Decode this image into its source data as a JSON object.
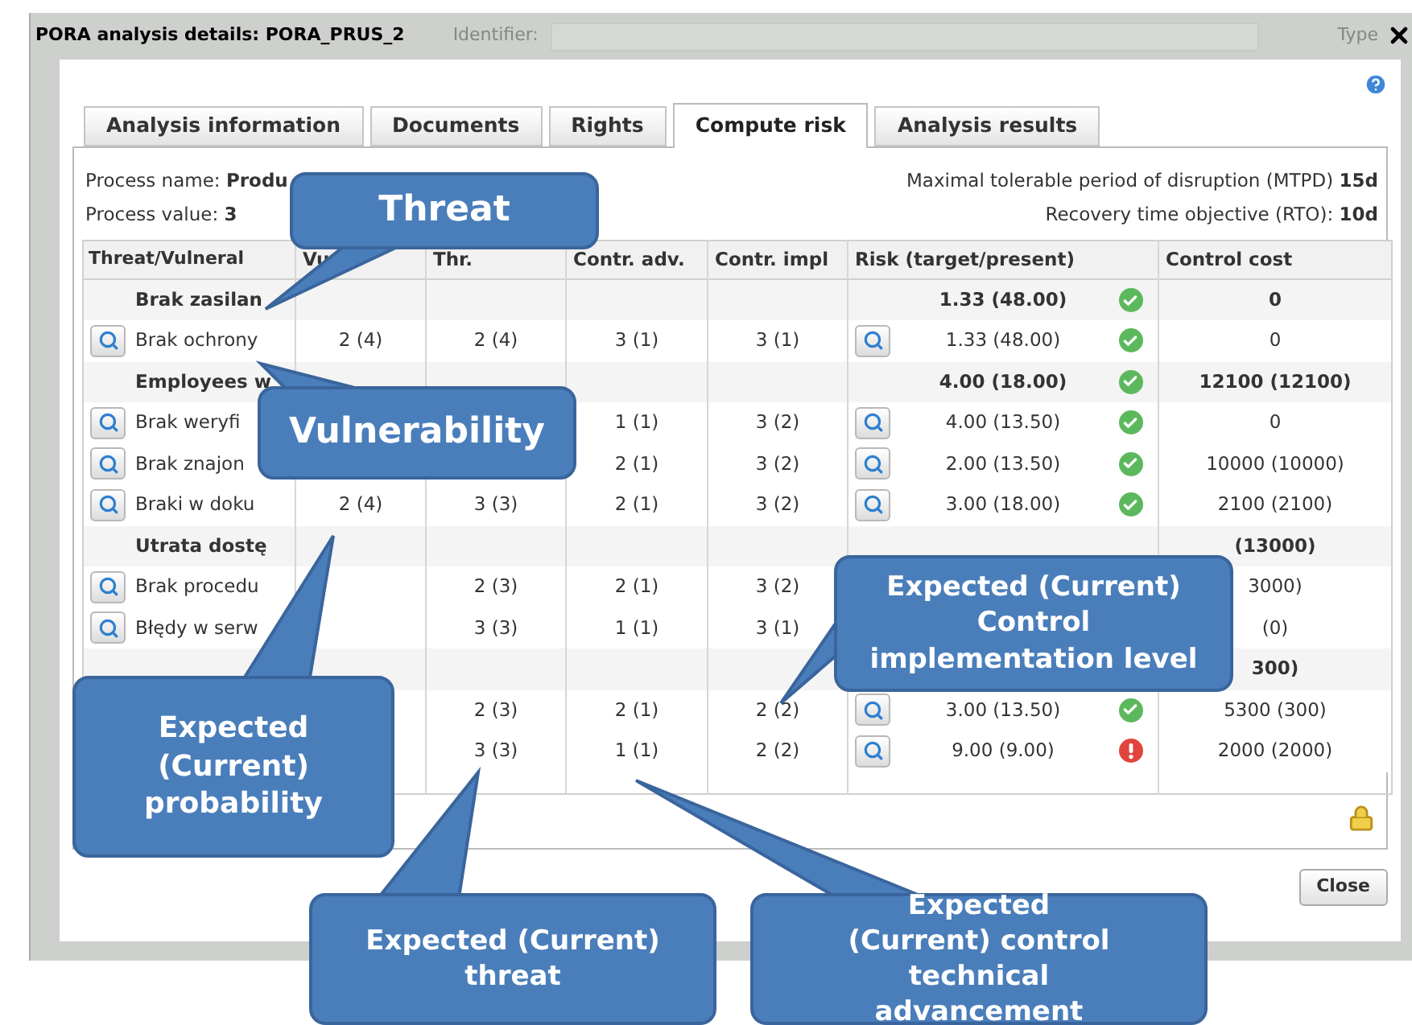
{
  "window": {
    "title": "PORA analysis details: PORA_PRUS_2"
  },
  "background_text": [
    "Identifier:",
    "Type"
  ],
  "tabs": [
    {
      "label": "Analysis information",
      "selected": false
    },
    {
      "label": "Documents",
      "selected": false
    },
    {
      "label": "Rights",
      "selected": false
    },
    {
      "label": "Compute risk",
      "selected": true
    },
    {
      "label": "Analysis results",
      "selected": false
    }
  ],
  "process": {
    "name_label": "Process name:",
    "name_value": "Produ",
    "value_label": "Process value:",
    "value_value": "3",
    "mtpd_label": "Maximal tolerable period of disruption (MTPD)",
    "mtpd_value": "15d",
    "rto_label": "Recovery time objective (RTO):",
    "rto_value": "10d"
  },
  "table": {
    "columns": [
      "Threat/Vulneral",
      "Vu",
      "Thr.",
      "Contr. adv.",
      "Contr. impl",
      "Risk (target/present)",
      "Control cost"
    ],
    "rows": [
      {
        "kind": "group",
        "name": "Brak zasilan",
        "risk": "1.33 (48.00)",
        "within_target": true,
        "cost": "0"
      },
      {
        "kind": "item",
        "details": true,
        "name": "Brak ochrony",
        "vuln": "2 (4)",
        "thr": "2 (4)",
        "adv": "3 (1)",
        "impl": "3 (1)",
        "risk_details": true,
        "risk": "1.33 (48.00)",
        "within_target": true,
        "cost": "0"
      },
      {
        "kind": "group",
        "name": "Employees w",
        "risk": "4.00 (18.00)",
        "within_target": true,
        "cost": "12100 (12100)"
      },
      {
        "kind": "item",
        "details": true,
        "name": "Brak weryfi",
        "adv": "1 (1)",
        "impl": "3 (2)",
        "risk_details": true,
        "risk": "4.00 (13.50)",
        "within_target": true,
        "cost": "0"
      },
      {
        "kind": "item",
        "details": true,
        "name": "Brak znajon",
        "adv": "2 (1)",
        "impl": "3 (2)",
        "risk_details": true,
        "risk": "2.00 (13.50)",
        "within_target": true,
        "cost": "10000 (10000)"
      },
      {
        "kind": "item",
        "details": true,
        "name": "Braki w doku",
        "vuln": "2 (4)",
        "thr": "3 (3)",
        "adv": "2 (1)",
        "impl": "3 (2)",
        "risk_details": true,
        "risk": "3.00 (18.00)",
        "within_target": true,
        "cost": "2100 (2100)"
      },
      {
        "kind": "group",
        "name": "Utrata dostę",
        "cost": "(13000)"
      },
      {
        "kind": "item",
        "details": true,
        "name": "Brak procedu",
        "thr": "2 (3)",
        "adv": "2 (1)",
        "impl": "3 (2)",
        "cost": "3000)"
      },
      {
        "kind": "item",
        "details": true,
        "name": "Błędy w serw",
        "thr": "3 (3)",
        "adv": "1 (1)",
        "impl": "3 (1)",
        "cost": "(0)"
      },
      {
        "kind": "group",
        "cost": "300)"
      },
      {
        "kind": "item",
        "thr": "2 (3)",
        "adv": "2 (1)",
        "impl": "2 (2)",
        "risk_details": true,
        "risk": "3.00 (13.50)",
        "within_target": true,
        "cost": "5300 (300)"
      },
      {
        "kind": "item",
        "thr": "3 (3)",
        "adv": "1 (1)",
        "impl": "2 (2)",
        "risk_details": true,
        "risk": "9.00 (9.00)",
        "within_target": false,
        "cost": "2000 (2000)"
      }
    ]
  },
  "close_button": "Close",
  "callouts": [
    {
      "text": "Threat"
    },
    {
      "text": "Vulnerability"
    },
    {
      "text": "Expected (Current) probability"
    },
    {
      "text": "Expected (Current) Control implementation level"
    },
    {
      "text": "Expected (Current) threat"
    },
    {
      "text": "Expected (Current) control technical advancement"
    }
  ]
}
